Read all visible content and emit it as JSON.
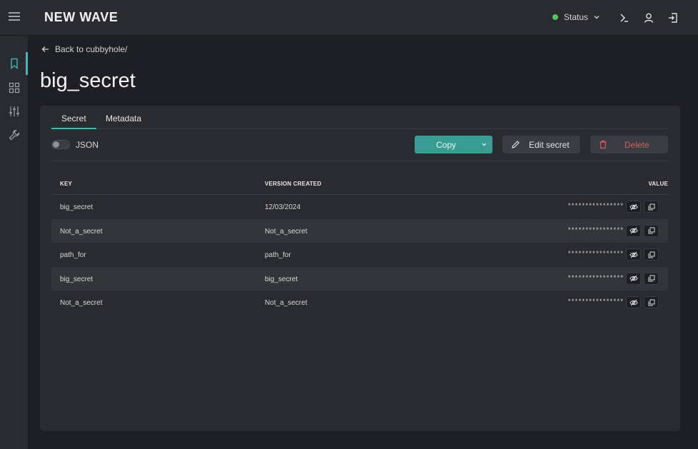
{
  "header": {
    "brand": "NEW WAVE",
    "status_label": "Status",
    "status_color": "#4ec65a"
  },
  "sidebar": {
    "items": [
      "bookmark-icon",
      "grid-icon",
      "sliders-icon",
      "wrench-icon"
    ],
    "active": "bookmark-icon",
    "accent": "#3fb8b0"
  },
  "breadcrumb": {
    "back_label": "Back to cubbyhole/"
  },
  "page": {
    "title": "big_secret"
  },
  "tabs": [
    {
      "label": "Secret",
      "active": true
    },
    {
      "label": "Metadata",
      "active": false
    }
  ],
  "toolbar": {
    "json_toggle_label": "JSON",
    "json_toggle_on": false,
    "copy_label": "Copy",
    "edit_label": "Edit secret",
    "delete_label": "Delete"
  },
  "table": {
    "columns": [
      "KEY",
      "VERSION CREATED",
      "VALUE"
    ],
    "rows": [
      {
        "key": "big_secret",
        "version": "12/03/2024",
        "value": "****************"
      },
      {
        "key": "Not_a_secret",
        "version": "Not_a_secret",
        "value": "****************"
      },
      {
        "key": "path_for",
        "version": "path_for",
        "value": "****************"
      },
      {
        "key": "big_secret",
        "version": "big_secret",
        "value": "****************"
      },
      {
        "key": "Not_a_secret",
        "version": "Not_a_secret",
        "value": "****************"
      }
    ]
  }
}
